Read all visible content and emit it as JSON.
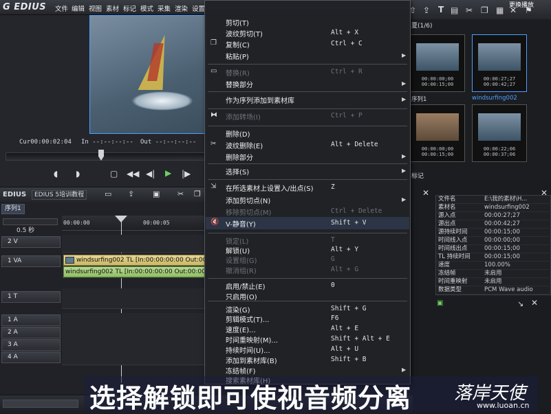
{
  "app": {
    "title": "EDIUS"
  },
  "menubar": {
    "items": [
      "文件",
      "编辑",
      "视图",
      "素材",
      "标记",
      "模式",
      "采集",
      "渲染",
      "设置"
    ]
  },
  "preview": {
    "timecode_label": "Cur",
    "timecode": "00:00:02:04",
    "in_label": "In",
    "in_value": "--:--:--:--",
    "out_label": "Out",
    "out_value": "--:--:--:--"
  },
  "timeline": {
    "app_label": "EDIUS",
    "project_name": "EDIUS 5培训教程",
    "sequence_tab": "序列1",
    "zoom": "0.5 秒",
    "ruler_start": "00:00:00",
    "ruler_mid": "00:00:05",
    "tracks": [
      "2 V",
      "1 VA",
      "1 T",
      "1 A",
      "2 A",
      "3 A",
      "4 A"
    ],
    "clip_video": "windsurfing002  TL [In:00:00:00:00 Out:00",
    "clip_audio": "windsurfing002  TL [In:00:00:00:00 Out:00:00"
  },
  "bin": {
    "header": "夏(1/6)",
    "thumbs": [
      {
        "in": "00:00:00;00",
        "out": "00:00:15;00",
        "label": "序列1"
      },
      {
        "in": "00:00:27;27",
        "out": "00:00:42;27",
        "label": "windsurfing002"
      },
      {
        "in": "00:00:00;00",
        "out": "00:00:15;00",
        "label": ""
      },
      {
        "in": "00:00:22;06",
        "out": "00:00:37;06",
        "label": ""
      }
    ],
    "tab_label": "标记"
  },
  "properties": {
    "rows": [
      {
        "k": "文件名",
        "v": "E:\\我的素材\\H..."
      },
      {
        "k": "素材名",
        "v": "windsurfing002"
      },
      {
        "k": "源入点",
        "v": "00:00:27;27"
      },
      {
        "k": "源出点",
        "v": "00:00:42;27"
      },
      {
        "k": "源持续时间",
        "v": "00:00:15;00"
      },
      {
        "k": "时间线入点",
        "v": "00:00:00;00"
      },
      {
        "k": "时间线出点",
        "v": "00:00:15;00"
      },
      {
        "k": "TL 持续时间",
        "v": "00:00:15;00"
      },
      {
        "k": "速度",
        "v": "100.00%"
      },
      {
        "k": "冻结帧",
        "v": "未启用"
      },
      {
        "k": "时间重映射",
        "v": "未启用"
      },
      {
        "k": "数据类型",
        "v": "PCM Wave audio"
      }
    ]
  },
  "context_menu": {
    "items": [
      {
        "label": "剪切(T)",
        "shortcut": "",
        "disabled": false,
        "sub": false
      },
      {
        "label": "波纹剪切(T)",
        "shortcut": "Alt + X",
        "disabled": false,
        "sub": false
      },
      {
        "label": "复制(C)",
        "shortcut": "Ctrl + C",
        "disabled": false,
        "sub": false,
        "icon": "copy-icon"
      },
      {
        "label": "粘贴(P)",
        "shortcut": "",
        "disabled": false,
        "sub": true
      },
      {
        "label": "替换(R)",
        "shortcut": "Ctrl + R",
        "disabled": true,
        "sub": false,
        "icon": "replace-icon"
      },
      {
        "label": "替换部分",
        "shortcut": "",
        "disabled": false,
        "sub": true
      },
      {
        "label": "作为序列添加到素材库",
        "shortcut": "",
        "disabled": false,
        "sub": true
      },
      {
        "label": "添加转场(I)",
        "shortcut": "Ctrl + P",
        "disabled": true,
        "sub": false,
        "icon": "transition-icon"
      },
      {
        "label": "删除(D)",
        "shortcut": "",
        "disabled": false,
        "sub": false
      },
      {
        "label": "波纹删除(E)",
        "shortcut": "Alt + Delete",
        "disabled": false,
        "sub": false,
        "icon": "ripple-delete-icon"
      },
      {
        "label": "删除部分",
        "shortcut": "",
        "disabled": false,
        "sub": true
      },
      {
        "label": "选择(S)",
        "shortcut": "",
        "disabled": false,
        "sub": true
      },
      {
        "label": "在所选素材上设置入/出点(S)",
        "shortcut": "Z",
        "disabled": false,
        "sub": false,
        "icon": "inout-icon"
      },
      {
        "label": "添加剪切点(N)",
        "shortcut": "",
        "disabled": false,
        "sub": true
      },
      {
        "label": "移除剪切点(M)",
        "shortcut": "Ctrl + Delete",
        "disabled": true,
        "sub": false
      },
      {
        "label": "V-静音(Y)",
        "shortcut": "Shift + V",
        "disabled": false,
        "sub": false,
        "icon": "mute-icon"
      },
      {
        "label": "锁定(L)",
        "shortcut": "T",
        "disabled": true,
        "sub": false
      },
      {
        "label": "解锁(U)",
        "shortcut": "Alt + Y",
        "disabled": false,
        "sub": false
      },
      {
        "label": "设置组(G)",
        "shortcut": "G",
        "disabled": true,
        "sub": false
      },
      {
        "label": "撤消组(R)",
        "shortcut": "Alt + G",
        "disabled": true,
        "sub": false
      },
      {
        "label": "启用/禁止(E)",
        "shortcut": "0",
        "disabled": false,
        "sub": false
      },
      {
        "label": "只启用(O)",
        "shortcut": "",
        "disabled": false,
        "sub": false
      },
      {
        "label": "渲染(G)",
        "shortcut": "Shift + G",
        "disabled": false,
        "sub": false
      },
      {
        "label": "剪辑模式(T)...",
        "shortcut": "F6",
        "disabled": false,
        "sub": false
      },
      {
        "label": "速度(E)...",
        "shortcut": "Alt + E",
        "disabled": false,
        "sub": false
      },
      {
        "label": "时间重映射(M)...",
        "shortcut": "Shift + Alt + E",
        "disabled": false,
        "sub": false
      },
      {
        "label": "持续时间(U)...",
        "shortcut": "Alt + U",
        "disabled": false,
        "sub": false
      },
      {
        "label": "添加到素材库(B)",
        "shortcut": "Shift + B",
        "disabled": false,
        "sub": false
      },
      {
        "label": "冻结帧(F)",
        "shortcut": "",
        "disabled": false,
        "sub": true
      },
      {
        "label": "搜索素材库(H)",
        "shortcut": "",
        "disabled": false,
        "sub": false
      }
    ]
  },
  "caption": {
    "text": "选择解锁即可使视音频分离"
  },
  "brand": {
    "name": "落岸天使",
    "site": "www.luoan.cn"
  },
  "topright": {
    "label": "更换播放"
  },
  "colors": {
    "accent": "#4fa0ff",
    "clip_video": "#d9c87a",
    "clip_audio": "#a6cf7c"
  }
}
